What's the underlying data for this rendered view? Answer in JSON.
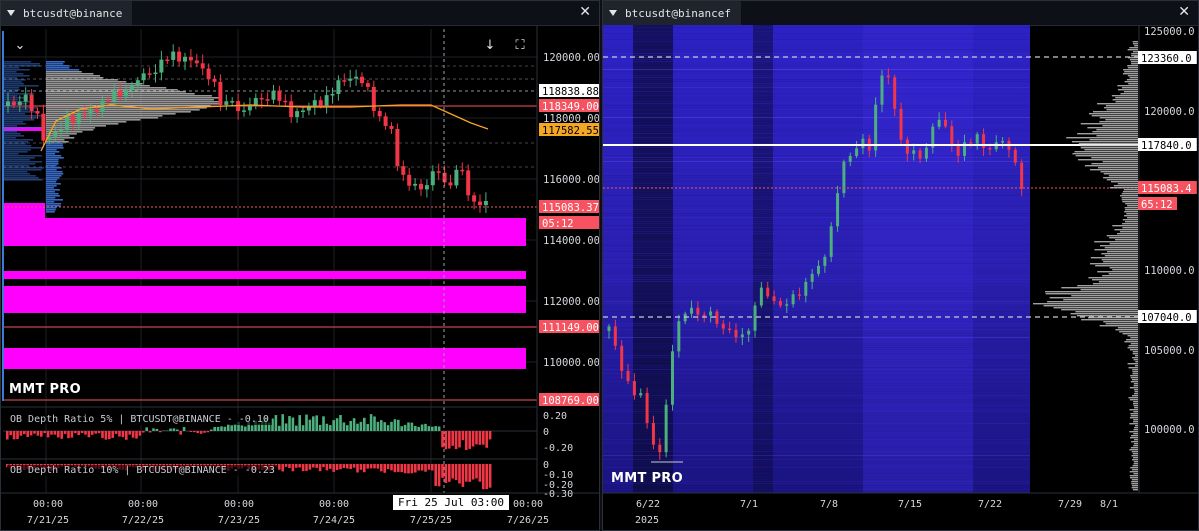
{
  "left": {
    "tab_title": "btcusdt@binance",
    "brand": "MMT PRO",
    "y_axis_labels": [
      "120000.00",
      "118000.00",
      "116000.00",
      "114000.00",
      "112000.00",
      "110000.00"
    ],
    "price_tags": [
      {
        "text": "118838.88",
        "bg": "#ffffff",
        "fg": "#000000"
      },
      {
        "text": "118349.00",
        "bg": "#f7525f",
        "fg": "#ffffff"
      },
      {
        "text": "117582.55",
        "bg": "#f5a623",
        "fg": "#000000"
      },
      {
        "text": "115083.37",
        "bg": "#f7525f",
        "fg": "#ffffff"
      },
      {
        "text": "05:12",
        "bg": "#f7525f",
        "fg": "#ffffff"
      },
      {
        "text": "111149.00",
        "bg": "#f7525f",
        "fg": "#ffffff"
      },
      {
        "text": "108769.00",
        "bg": "#f7525f",
        "fg": "#ffffff"
      }
    ],
    "indicator1": {
      "title": "OB Depth Ratio 5% | BTCUSDT@BINANCE - -0.10",
      "axis": [
        "0.20",
        "0",
        "-0.20"
      ]
    },
    "indicator2": {
      "title": "OB Depth Ratio 10% | BTCUSDT@BINANCE - -0.23",
      "axis": [
        "0",
        "-0.10",
        "-0.20",
        "-0.30"
      ]
    },
    "time_labels": [
      {
        "time": "00:00",
        "date": "7/21/25"
      },
      {
        "time": "00:00",
        "date": "7/22/25"
      },
      {
        "time": "00:00",
        "date": "7/23/25"
      },
      {
        "time": "00:00",
        "date": "7/24/25"
      },
      {
        "time": "",
        "date": "7/25/25"
      },
      {
        "time": "00:00",
        "date": "7/26/25"
      }
    ],
    "crosshair_tip": "Fri 25 Jul 03:00",
    "buttons": {
      "collapse_icon": "chevron-down-icon",
      "scroll_icon": "arrow-down-icon",
      "fullscreen_icon": "fullscreen-icon"
    }
  },
  "right": {
    "tab_title": "btcusdt@binancef",
    "brand": "MMT PRO",
    "y_axis_labels": [
      "125000.0",
      "120000.0",
      "110000.0",
      "105000.0",
      "100000.0"
    ],
    "price_tags": [
      {
        "text": "123360.0",
        "bg": "#ffffff",
        "fg": "#000000"
      },
      {
        "text": "117840.0",
        "bg": "#ffffff",
        "fg": "#000000"
      },
      {
        "text": "115083.4",
        "bg": "#f7525f",
        "fg": "#ffffff"
      },
      {
        "text": "65:12",
        "bg": "#f7525f",
        "fg": "#ffffff"
      },
      {
        "text": "107040.0",
        "bg": "#ffffff",
        "fg": "#000000"
      }
    ],
    "time_labels": [
      "6/22",
      "7/1",
      "7/8",
      "7/15",
      "7/22",
      "7/29",
      "8/1"
    ],
    "year_label": "2025"
  },
  "colors": {
    "up": "#4caf7d",
    "down": "#f23645",
    "magenta": "#ff00ff",
    "ma": "#f5a623",
    "heat": "#2a1fb0"
  }
}
